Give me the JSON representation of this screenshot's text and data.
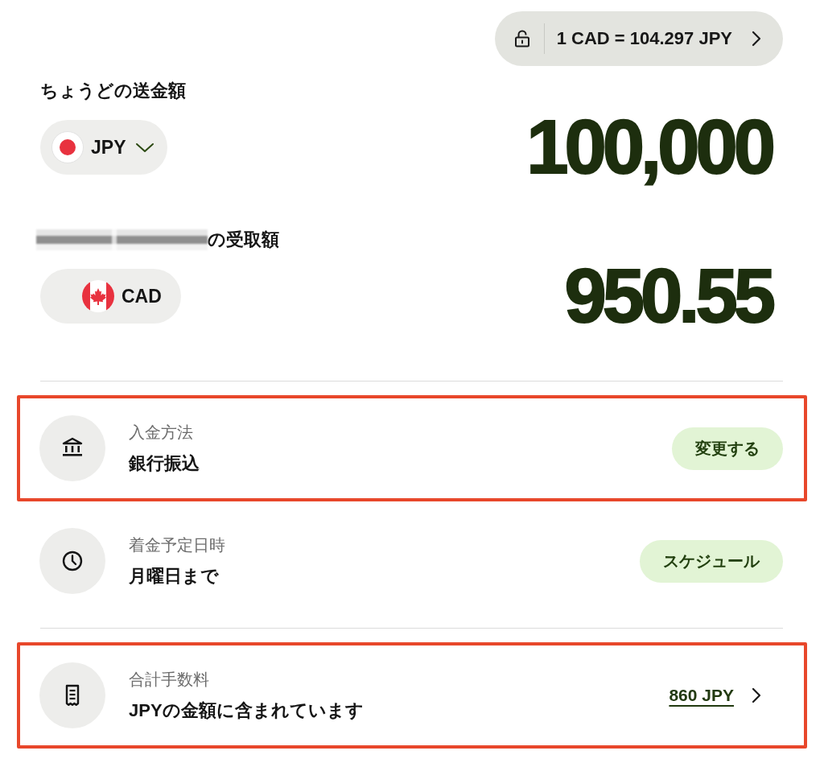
{
  "rate": {
    "locked": false,
    "text": "1 CAD = 104.297 JPY"
  },
  "send": {
    "label": "ちょうどの送金額",
    "currency": {
      "code": "JPY",
      "dropdown": true
    },
    "amount": "100,000"
  },
  "receive": {
    "name_redacted": true,
    "label": "の受取額",
    "currency": {
      "code": "CAD",
      "dropdown": false
    },
    "amount": "950.55"
  },
  "sections": [
    {
      "rows": [
        {
          "label": "入金方法",
          "value": "銀行振込",
          "highlighted": true,
          "action": {
            "kind": "button",
            "text": "変更する"
          }
        },
        {
          "label": "着金予定日時",
          "value": "月曜日まで",
          "highlighted": false,
          "action": {
            "kind": "button",
            "text": "スケジュール"
          }
        }
      ]
    },
    {
      "rows": [
        {
          "label": "合計手数料",
          "value": "JPYの金額に含まれています",
          "highlighted": true,
          "action": {
            "kind": "link",
            "text": "860 JPY"
          }
        }
      ]
    }
  ]
}
